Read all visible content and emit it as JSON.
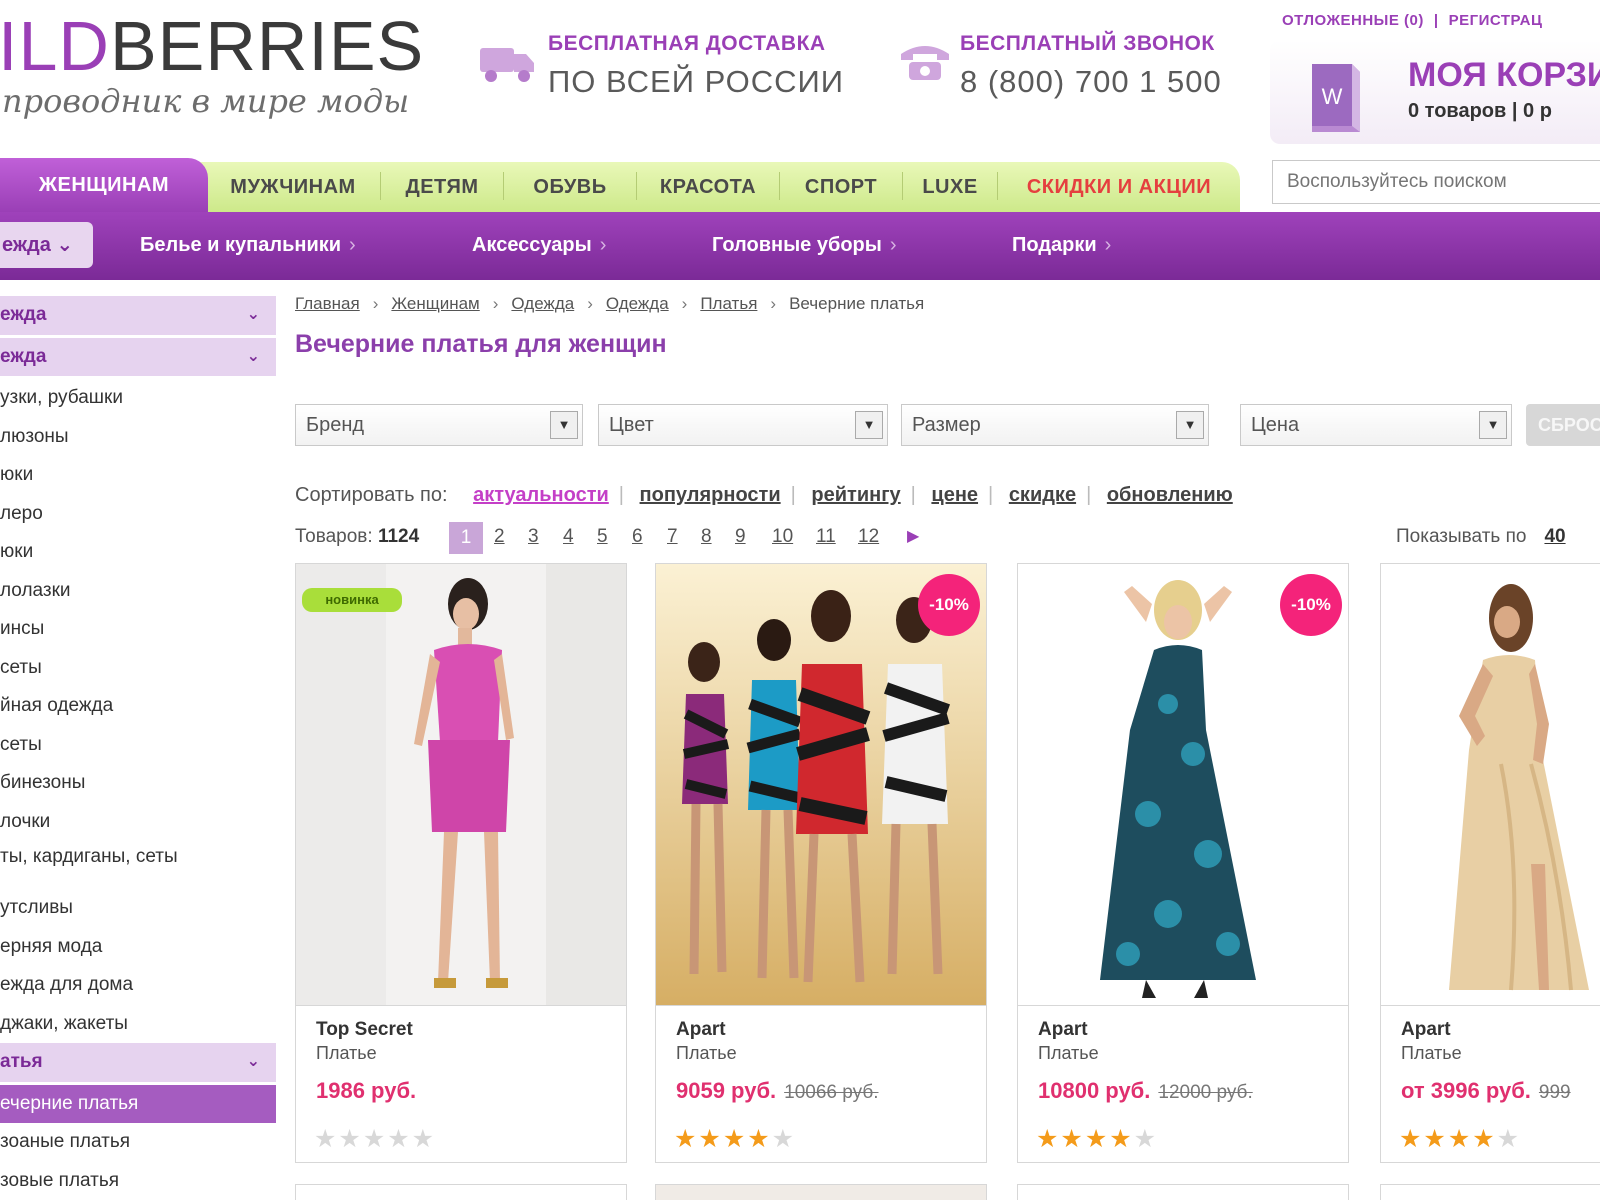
{
  "header": {
    "logo_accent": "ILD",
    "logo_main": "BERRIES",
    "tagline": "проводник в мире моды",
    "delivery_small": "БЕСПЛАТНАЯ ДОСТАВКА",
    "delivery_big": "ПО ВСЕЙ РОССИИ",
    "phone_small": "БЕСПЛАТНЫЙ ЗВОНОК",
    "phone_big": "8 (800) 700 1 500",
    "toplink_saved": "ОТЛОЖЕННЫЕ (0)",
    "toplink_sep": "|",
    "toplink_register": "РЕГИСТРАЦ",
    "cart_title": "МОЯ КОРЗИ",
    "cart_sub": "0 товаров | 0 р"
  },
  "tabs": [
    {
      "label": "ЖЕНЩИНАМ"
    },
    {
      "label": "МУЖЧИНАМ"
    },
    {
      "label": "ДЕТЯМ"
    },
    {
      "label": "ОБУВЬ"
    },
    {
      "label": "КРАСОТА"
    },
    {
      "label": "СПОРТ"
    },
    {
      "label": "LUXE"
    },
    {
      "label": "СКИДКИ И АКЦИИ"
    }
  ],
  "search": {
    "placeholder": "Воспользуйтесь поиском"
  },
  "subnav": {
    "dropdown": "ежда ⌄",
    "items": [
      {
        "label": "Белье и купальники"
      },
      {
        "label": "Аксессуары"
      },
      {
        "label": "Головные уборы"
      },
      {
        "label": "Подарки"
      }
    ],
    "chevron": "›"
  },
  "sidebar": {
    "items": [
      {
        "label": "ежда"
      },
      {
        "label": "ежда"
      },
      {
        "label": "узки, рубашки"
      },
      {
        "label": "люзоны"
      },
      {
        "label": "юки"
      },
      {
        "label": "леро"
      },
      {
        "label": "юки"
      },
      {
        "label": "лолазки"
      },
      {
        "label": "инсы"
      },
      {
        "label": "сеты"
      },
      {
        "label": "йная одежда"
      },
      {
        "label": "сеты"
      },
      {
        "label": "бинезоны"
      },
      {
        "label": "лочки"
      },
      {
        "label": "ты, кардиганы, сеты"
      },
      {
        "label": "утсливы"
      },
      {
        "label": "ерняя мода"
      },
      {
        "label": "ежда для дома"
      },
      {
        "label": "джаки, жакеты"
      },
      {
        "label": "атья"
      },
      {
        "label": "ечерние платья"
      },
      {
        "label": "зоаные платья"
      },
      {
        "label": "зовые платья"
      }
    ],
    "caret": "⌄"
  },
  "breadcrumb": {
    "items": [
      "Главная",
      "Женщинам",
      "Одежда",
      "Одежда",
      "Платья"
    ],
    "current": "Вечерние платья",
    "sep": "›"
  },
  "page_title": "Вечерние платья для женщин",
  "filters": {
    "brand": "Бренд",
    "color": "Цвет",
    "size": "Размер",
    "price": "Цена",
    "arrow": "▼",
    "reset": "СБРОС"
  },
  "sort": {
    "label": "Сортировать по:",
    "options": [
      "актуальности",
      "популярности",
      "рейтингу",
      "цене",
      "скидке",
      "обновлению"
    ],
    "sep": "|"
  },
  "pager": {
    "count_label": "Товаров:",
    "count": "1124",
    "pages": [
      "1",
      "2",
      "3",
      "4",
      "5",
      "6",
      "7",
      "8",
      "9",
      "10",
      "11",
      "12"
    ],
    "current_page": 1,
    "next": "▶",
    "showby_label": "Показывать по",
    "showby_value": "40"
  },
  "products": [
    {
      "brand": "Top Secret",
      "type": "Платье",
      "price": "1986 руб.",
      "old_price": "",
      "badge": "новинка",
      "rating": 0
    },
    {
      "brand": "Apart",
      "type": "Платье",
      "price": "9059 руб.",
      "old_price": "10066 руб.",
      "badge": "-10%",
      "rating": 4
    },
    {
      "brand": "Apart",
      "type": "Платье",
      "price": "10800 руб.",
      "old_price": "12000 руб.",
      "badge": "-10%",
      "rating": 4
    },
    {
      "brand": "Apart",
      "type": "Платье",
      "price": "от 3996 руб.",
      "old_price": "999",
      "badge": "",
      "rating": 4
    }
  ],
  "colors": {
    "brand_purple": "#9a3fb6",
    "tab_green": "#cde98a",
    "price_pink": "#e0306f",
    "discount_pink": "#f4237a",
    "star_orange": "#f49b1a"
  }
}
